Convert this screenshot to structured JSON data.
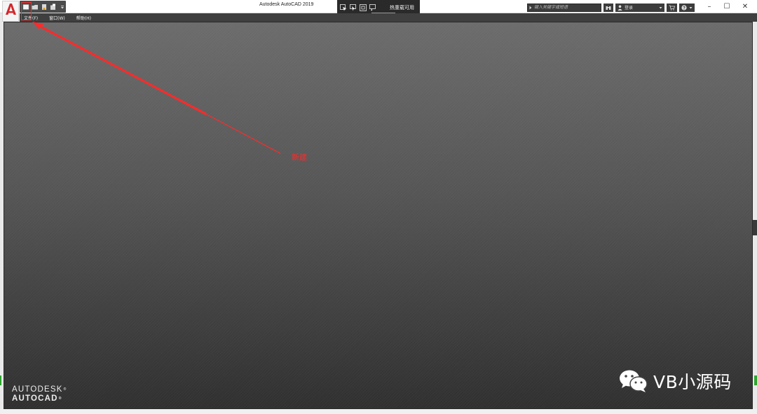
{
  "window": {
    "title": "Autodesk AutoCAD 2019"
  },
  "hot_reload": {
    "label": "热重载可用"
  },
  "search": {
    "placeholder": "键入关键字或短语"
  },
  "user": {
    "signin_label": "登录"
  },
  "window_controls": {
    "minimize": "–",
    "maximize": "☐",
    "close": "✕"
  },
  "menu": {
    "items": [
      {
        "label": "文件(F)"
      },
      {
        "label": "窗口(W)"
      },
      {
        "label": "帮助(H)"
      }
    ]
  },
  "brand": {
    "line1": "AUTODESK",
    "line2": "AUTOCAD",
    "reg": "®"
  },
  "annotation": {
    "label": "新建"
  },
  "watermark": {
    "text": "VB小源码"
  },
  "icons": {
    "app": "autocad-logo-icon",
    "new": "new-file-icon",
    "open": "open-folder-icon",
    "save": "save-icon",
    "save_as": "save-as-icon",
    "qat_menu": "dropdown-arrow-icon",
    "select_element": "select-element-icon",
    "display_selection": "display-selection-icon",
    "track_focus": "track-focus-icon",
    "visual_tree": "visual-tree-icon",
    "exchange": "exchange-apps-icon",
    "user": "user-icon",
    "cart": "cart-icon",
    "help": "help-icon"
  },
  "colors": {
    "accent_red": "#ff2a2a",
    "canvas_top": "#6c6c6c",
    "canvas_bottom": "#303030"
  }
}
